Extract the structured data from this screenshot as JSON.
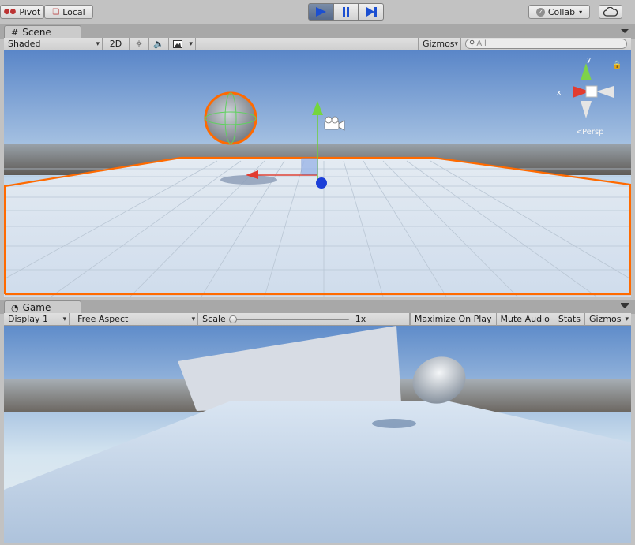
{
  "toolbar": {
    "pivot_label": "Pivot",
    "local_label": "Local",
    "collab_label": "Collab",
    "colors": {
      "play_active": "#5a6e90",
      "play_icon": "#1b4fd1"
    }
  },
  "scene": {
    "tab_label": "Scene",
    "shading_mode": "Shaded",
    "mode_2d_label": "2D",
    "gizmos_label": "Gizmos",
    "search_placeholder": "All",
    "persp_label": "Persp",
    "axis_x_label": "x",
    "axis_y_label": "y",
    "selection_color": "#ff6a00"
  },
  "game": {
    "tab_label": "Game",
    "display_label": "Display 1",
    "aspect_label": "Free Aspect",
    "scale_label": "Scale",
    "scale_value": "1x",
    "maximize_label": "Maximize On Play",
    "mute_label": "Mute Audio",
    "stats_label": "Stats",
    "gizmos_label": "Gizmos"
  }
}
